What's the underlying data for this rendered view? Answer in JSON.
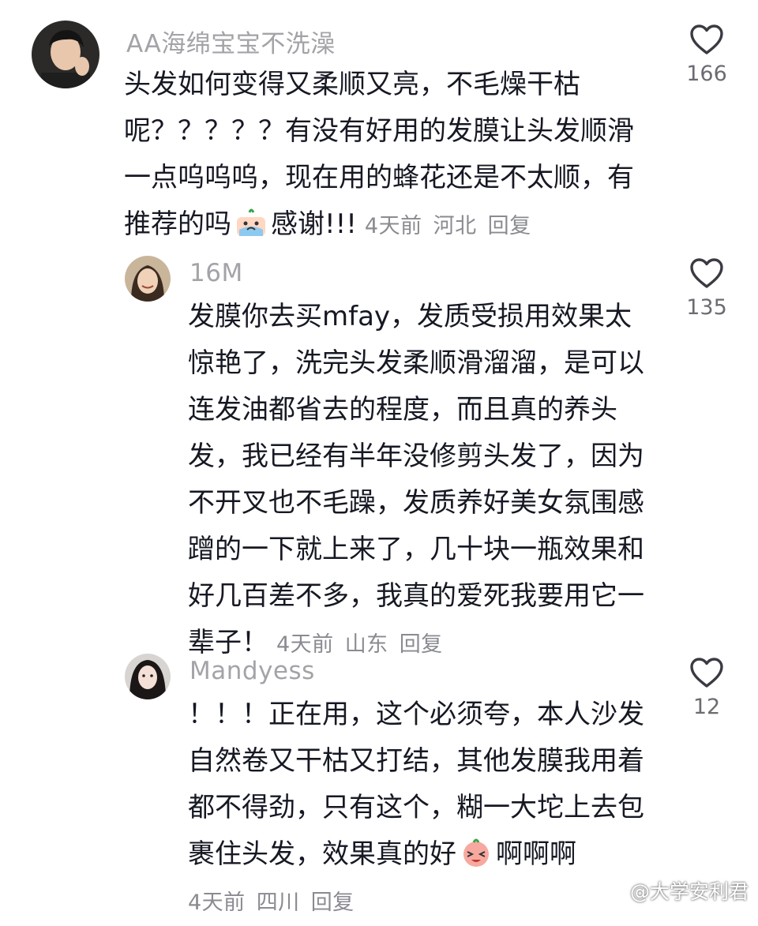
{
  "comments": [
    {
      "username": "AA海绵宝宝不洗澡",
      "text_before_emoji": "头发如何变得又柔顺又亮，不毛燥干枯呢？？？？？有没有好用的发膜让头发顺滑一点呜呜呜，现在用的蜂花还是不太顺，有推荐的吗",
      "emoji_icon": "crying-emoji",
      "text_after_emoji": "感谢!!!",
      "time": "4天前",
      "location": "河北",
      "reply_label": "回复",
      "likes": "166"
    },
    {
      "username": "16M",
      "text_before_emoji": "发膜你去买mfay，发质受损用效果太惊艳了，洗完头发柔顺滑溜溜，是可以连发油都省去的程度，而且真的养头发，我已经有半年没修剪头发了，因为不开叉也不毛躁，发质养好美女氛围感蹭的一下就上来了，几十块一瓶效果和好几百差不多，我真的爱死我要用它一辈子！",
      "time": "4天前",
      "location": "山东",
      "reply_label": "回复",
      "likes": "135"
    },
    {
      "username": "Mandyess",
      "text_before_emoji": "！！！正在用，这个必须夸，本人沙发自然卷又干枯又打结，其他发膜我用着都不得劲，只有这个，糊一大坨上去包裹住头发，效果真的好",
      "emoji_icon": "laughing-crying-emoji",
      "text_after_emoji": "啊啊啊",
      "time": "4天前",
      "location": "四川",
      "reply_label": "回复",
      "likes": "12"
    }
  ],
  "watermark": {
    "text": "@大学安利君",
    "icon": "weibo-icon"
  },
  "colors": {
    "username": "#a3a3a8",
    "body": "#161823",
    "meta": "#8a8b91"
  }
}
